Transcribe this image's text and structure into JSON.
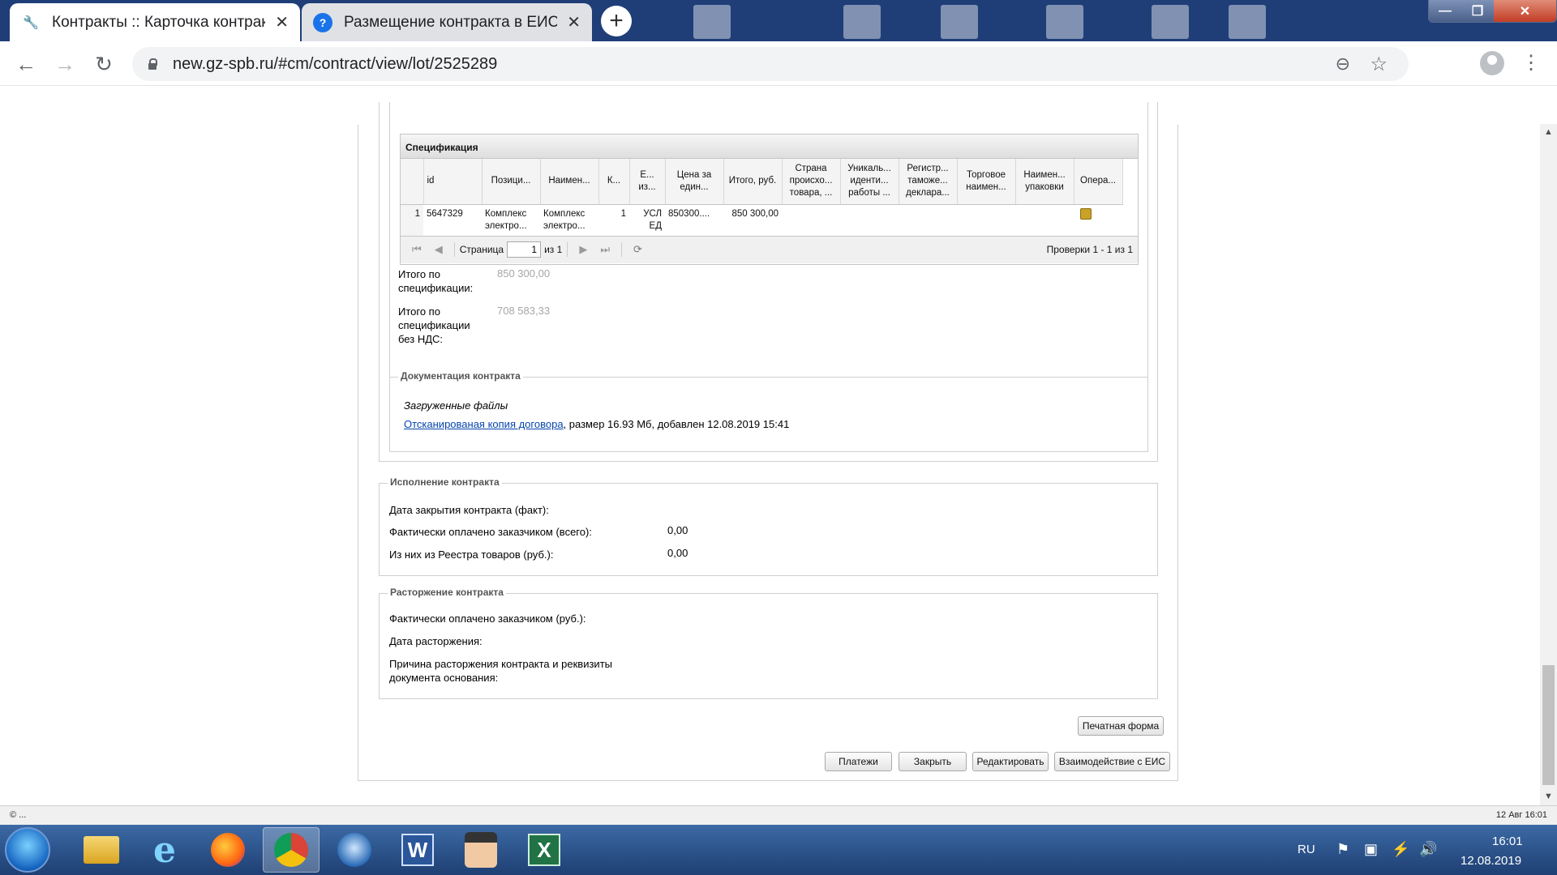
{
  "browser": {
    "tabs": [
      {
        "title": "Контракты :: Карточка контракт",
        "close": "✕",
        "icon": "tools-icon",
        "active": true
      },
      {
        "title": "Размещение контракта в ЕИС |",
        "close": "✕",
        "icon": "help-icon",
        "active": false
      }
    ],
    "new_tab": "+",
    "url": "new.gz-spb.ru/#cm/contract/view/lot/2525289",
    "window_controls": {
      "minimize": "—",
      "maximize": "❐",
      "close": "✕"
    }
  },
  "specification": {
    "title": "Спецификация",
    "columns": [
      "",
      "id",
      "Позици...",
      "Наимен...",
      "К...",
      "Е... из...",
      "Цена за един...",
      "Итого, руб.",
      "Страна происхо... товара, ...",
      "Уникаль... иденти... работы ...",
      "Регистр... таможе... деклара...",
      "Торговое наимен...",
      "Наимен... упаковки",
      "Опера..."
    ],
    "rows": [
      {
        "num": "1",
        "id": "5647329",
        "position": "Комплекс электро...",
        "name": "Комплекс электро...",
        "qty": "1",
        "unit": "УСЛ ЕД",
        "price": "850300....",
        "total": "850 300,00",
        "country": "",
        "unique": "",
        "customs": "",
        "trade": "",
        "package": "",
        "ops_icon": "scroll-icon"
      }
    ],
    "pager": {
      "page_label": "Страница",
      "page_value": "1",
      "of_label": "из 1",
      "info": "Проверки 1 - 1 из 1"
    }
  },
  "totals": {
    "total_label": "Итого по спецификации:",
    "total_value": "850 300,00",
    "total_nonds_label": "Итого по спецификации без НДС:",
    "total_nonds_value": "708 583,33"
  },
  "documentation": {
    "legend": "Документация контракта",
    "uploaded_label": "Загруженные файлы",
    "file_link": "Отсканированая копия договора",
    "file_info": ", размер 16.93 Мб, добавлен 12.08.2019 15:41"
  },
  "execution": {
    "legend": "Исполнение контракта",
    "close_date_label": "Дата закрытия контракта (факт):",
    "paid_total_label": "Фактически оплачено заказчиком (всего):",
    "paid_total_value": "0,00",
    "registry_label": "Из них из Реестра товаров (руб.):",
    "registry_value": "0,00"
  },
  "termination": {
    "legend": "Расторжение контракта",
    "paid_label": "Фактически оплачено заказчиком (руб.):",
    "date_label": "Дата расторжения:",
    "reason_label": "Причина расторжения контракта и реквизиты документа основания:"
  },
  "buttons": {
    "print": "Печатная форма",
    "payments": "Платежи",
    "close": "Закрыть",
    "edit": "Редактировать",
    "eis": "Взаимодействие с ЕИС"
  },
  "status": {
    "left": "© ...",
    "right": "12 Авг 16:01"
  },
  "taskbar": {
    "lang": "RU",
    "time": "16:01",
    "date": "12.08.2019",
    "apps": [
      "explorer-icon",
      "ie-icon",
      "firefox-icon",
      "chrome-icon",
      "thunderbird-icon",
      "word-icon",
      "professor-icon",
      "excel-icon"
    ],
    "word_letter": "W",
    "excel_letter": "X"
  }
}
